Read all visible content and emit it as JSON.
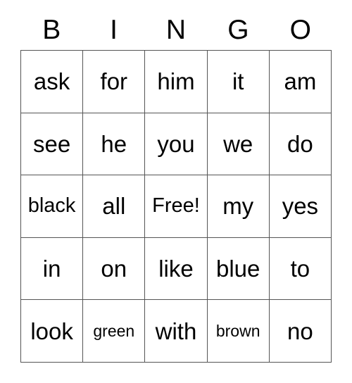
{
  "card": {
    "title": "BINGO",
    "header": [
      {
        "letter": "B"
      },
      {
        "letter": "I"
      },
      {
        "letter": "N"
      },
      {
        "letter": "G"
      },
      {
        "letter": "O"
      }
    ],
    "grid_size": "5x5",
    "colors": {
      "background": "#ffffff",
      "text": "#000000",
      "grid_line": "#555555"
    },
    "rows": [
      {
        "cells": [
          {
            "text": "ask",
            "size": "lg"
          },
          {
            "text": "for",
            "size": "lg"
          },
          {
            "text": "him",
            "size": "lg"
          },
          {
            "text": "it",
            "size": "lg"
          },
          {
            "text": "am",
            "size": "lg"
          }
        ]
      },
      {
        "cells": [
          {
            "text": "see",
            "size": "lg"
          },
          {
            "text": "he",
            "size": "lg"
          },
          {
            "text": "you",
            "size": "lg"
          },
          {
            "text": "we",
            "size": "lg"
          },
          {
            "text": "do",
            "size": "lg"
          }
        ]
      },
      {
        "cells": [
          {
            "text": "black",
            "size": "md"
          },
          {
            "text": "all",
            "size": "lg"
          },
          {
            "text": "Free!",
            "size": "md"
          },
          {
            "text": "my",
            "size": "lg"
          },
          {
            "text": "yes",
            "size": "lg"
          }
        ]
      },
      {
        "cells": [
          {
            "text": "in",
            "size": "lg"
          },
          {
            "text": "on",
            "size": "lg"
          },
          {
            "text": "like",
            "size": "lg"
          },
          {
            "text": "blue",
            "size": "lg"
          },
          {
            "text": "to",
            "size": "lg"
          }
        ]
      },
      {
        "cells": [
          {
            "text": "look",
            "size": "lg"
          },
          {
            "text": "green",
            "size": "sm"
          },
          {
            "text": "with",
            "size": "lg"
          },
          {
            "text": "brown",
            "size": "sm"
          },
          {
            "text": "no",
            "size": "lg"
          }
        ]
      }
    ]
  }
}
